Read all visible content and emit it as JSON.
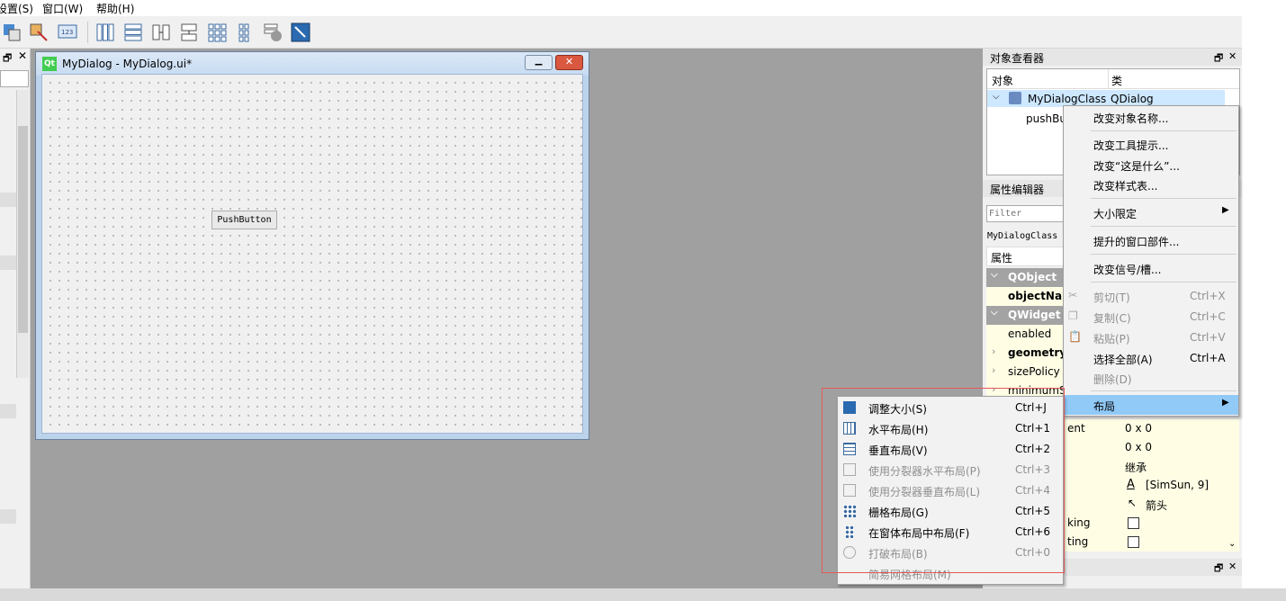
{
  "menubar": {
    "items": [
      "设置(S)",
      "窗口(W)",
      "帮助(H)"
    ]
  },
  "toolbar": {
    "icons": [
      "send-to-back-icon",
      "bring-to-front-icon",
      "tab-order-icon",
      "layout-horizontal-icon",
      "layout-vertical-icon",
      "splitter-horizontal-icon",
      "splitter-vertical-icon",
      "layout-grid-icon",
      "layout-form-icon",
      "break-layout-icon",
      "adjust-size-icon"
    ]
  },
  "form": {
    "title": "MyDialog - MyDialog.ui*",
    "logo": "Qt",
    "push_button": "PushButton"
  },
  "object_inspector": {
    "title": "对象查看器",
    "col_object": "对象",
    "col_class": "类",
    "root_name": "MyDialogClass",
    "root_class": "QDialog",
    "child_name": "pushBu"
  },
  "property_editor": {
    "title": "属性编辑器",
    "filter_placeholder": "Filter",
    "class_label": "MyDialogClass",
    "col_property": "属性",
    "groups": [
      "QObject",
      "QWidget"
    ],
    "props": {
      "objectName": "objectNar",
      "enabled": "enabled",
      "geometry": "geometry",
      "sizePolicy": "sizePolicy",
      "minimumSize": "minimumS"
    },
    "extra_rows": [
      {
        "name": "ent",
        "value": "0 x 0"
      },
      {
        "name": "",
        "value": "0 x 0"
      },
      {
        "name": "",
        "value": "继承"
      },
      {
        "name": "",
        "value": "[SimSun, 9]"
      },
      {
        "name": "",
        "value": "箭头"
      },
      {
        "name": "king",
        "value": ""
      },
      {
        "name": "ting",
        "value": ""
      }
    ]
  },
  "context_menu": {
    "items": [
      {
        "label": "改变对象名称..."
      },
      {
        "label": "改变工具提示..."
      },
      {
        "label": "改变“这是什么”..."
      },
      {
        "label": "改变样式表..."
      },
      {
        "label": "大小限定"
      },
      {
        "label": "提升的窗口部件..."
      },
      {
        "label": "改变信号/槽..."
      },
      {
        "label": "剪切(T)",
        "shortcut": "Ctrl+X"
      },
      {
        "label": "复制(C)",
        "shortcut": "Ctrl+C"
      },
      {
        "label": "粘贴(P)",
        "shortcut": "Ctrl+V"
      },
      {
        "label": "选择全部(A)",
        "shortcut": "Ctrl+A"
      },
      {
        "label": "删除(D)"
      },
      {
        "label": "布局"
      }
    ]
  },
  "layout_submenu": {
    "items": [
      {
        "label": "调整大小(S)",
        "shortcut": "Ctrl+J"
      },
      {
        "label": "水平布局(H)",
        "shortcut": "Ctrl+1"
      },
      {
        "label": "垂直布局(V)",
        "shortcut": "Ctrl+2"
      },
      {
        "label": "使用分裂器水平布局(P)",
        "shortcut": "Ctrl+3"
      },
      {
        "label": "使用分裂器垂直布局(L)",
        "shortcut": "Ctrl+4"
      },
      {
        "label": "栅格布局(G)",
        "shortcut": "Ctrl+5"
      },
      {
        "label": "在窗体布局中布局(F)",
        "shortcut": "Ctrl+6"
      },
      {
        "label": "打破布局(B)",
        "shortcut": "Ctrl+0"
      },
      {
        "label": "简易网格布局(M)"
      }
    ]
  },
  "colors": {
    "accent": "#91c9f7",
    "highlight_box": "#e25a5a",
    "group_header": "#a3a3a3",
    "property_row": "#fffee5"
  }
}
